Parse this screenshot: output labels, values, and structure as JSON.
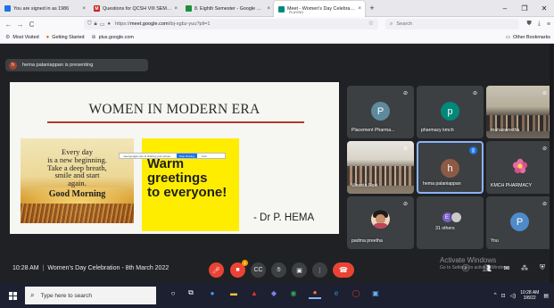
{
  "browser": {
    "tabs": [
      {
        "label": "You are signed in as 1986",
        "close": "×",
        "color": "#1a73e8"
      },
      {
        "label": "Questions for QCSH VIII SEM - ...",
        "close": "×",
        "color": "#c5221f"
      },
      {
        "label": "8. Eighth Semester - Google Dr...",
        "close": "×",
        "color": "#1e8e3e"
      },
      {
        "label": "Meet - Women's Day Celebratio...",
        "sub": "PLAYING",
        "close": "×",
        "color": "#00897b",
        "active": true
      }
    ],
    "new_tab": "+",
    "window_controls": {
      "minimize": "–",
      "restore": "❐",
      "close": "✕"
    },
    "nav": {
      "back": "←",
      "forward": "→",
      "reload": "C"
    },
    "url_prefix": "https://",
    "url_host": "meet.google.com",
    "url_path": "/ibj-xgbz-yuu?pli=1",
    "search_placeholder": "Search",
    "bookmarks": [
      "Most Visited",
      "Getting Started",
      "plus.google.com"
    ],
    "other_bookmarks": "Other Bookmarks"
  },
  "meet": {
    "presenter_initial": "h",
    "presenter_text": "hema palaniappan is presenting",
    "slide": {
      "title": "WOMEN IN MODERN ERA",
      "card_message": "Every day\nis a new beginning.\nTake a deep breath,\nsmile and start\nagain.",
      "card_greeting": "Good Morning",
      "warm_text": "Warm\ngreetings\nto everyone!",
      "signature": "- Dr P. HEMA",
      "share_notice": "meet.google.com is sharing your screen.",
      "share_stop": "Stop sharing",
      "share_hide": "Hide"
    },
    "participants": [
      {
        "name": "Placement Pharma...",
        "initial": "P",
        "avatar_color": "#5f8a9e",
        "kind": "avatar"
      },
      {
        "name": "pharmacy kmch",
        "initial": "p",
        "avatar_color": "#00897b",
        "kind": "avatar"
      },
      {
        "name": "mahasweetha",
        "kind": "photo"
      },
      {
        "name": "Vineeta Ravi",
        "kind": "photo2"
      },
      {
        "name": "hema palaniappan",
        "initial": "h",
        "avatar_color": "#8d5a45",
        "kind": "avatar",
        "speaking": true
      },
      {
        "name": "KMCH PHARMACY",
        "kind": "flower"
      },
      {
        "name": "padma preetha",
        "kind": "profile"
      },
      {
        "name": "31 others",
        "kind": "others",
        "others_initial": "E"
      },
      {
        "name": "You",
        "initial": "P",
        "avatar_color": "#4f8bc9",
        "kind": "avatar"
      }
    ],
    "time": "10:28 AM",
    "meeting_title": "Women's Day Celebration - 8th March 2022",
    "activate_title": "Activate Windows",
    "activate_sub": "Go to Settings to activate Windows.",
    "raise_count": "1"
  },
  "taskbar": {
    "search_placeholder": "Type here to search",
    "time": "10:28 AM",
    "date": "3/8/22"
  }
}
